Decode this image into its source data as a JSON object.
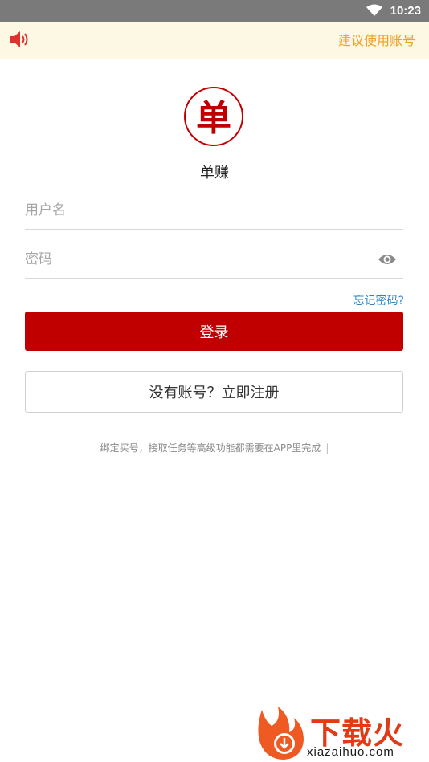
{
  "status_bar": {
    "time": "10:23",
    "wifi_icon": "wifi-icon"
  },
  "notice": {
    "icon": "speaker-icon",
    "text": "建议使用账号"
  },
  "app": {
    "logo_char": "单",
    "name": "单赚"
  },
  "form": {
    "username_placeholder": "用户名",
    "password_placeholder": "密码",
    "password_toggle_icon": "eye-icon",
    "forgot_label": "忘记密码?"
  },
  "buttons": {
    "login_label": "登录",
    "register_label": "没有账号？立即注册"
  },
  "hint": {
    "text": "绑定买号，接取任务等高级功能都需要在APP里完成",
    "cursor": "|"
  },
  "watermark": {
    "brand": "下载火",
    "url": "xiazaihuo.com"
  },
  "colors": {
    "brand_red": "#c00000",
    "notice_text": "#f0a020",
    "link_blue": "#2b86c8"
  }
}
